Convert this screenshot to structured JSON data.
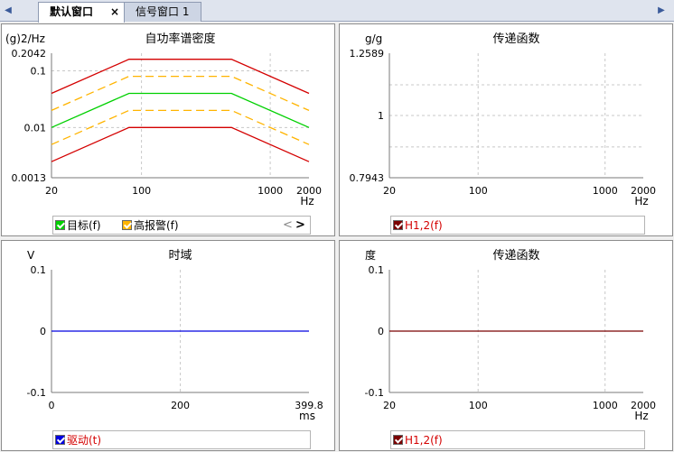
{
  "tabs": [
    {
      "label": "默认窗口",
      "active": true,
      "close": "×"
    },
    {
      "label": "信号窗口 1",
      "active": false
    }
  ],
  "tab_nav": {
    "left": "◀",
    "right": "▶"
  },
  "colors": {
    "abort": "#d40000",
    "alarm": "#ffb400",
    "target": "#00d000",
    "drive": "#0000e0",
    "h12": "#7a0000",
    "grid": "#c8c8c8"
  },
  "panels": {
    "psd": {
      "title": "自功率谱密度",
      "unit": "(g)2/Hz",
      "x_unit": "Hz",
      "legend": [
        {
          "label": "目标(f)",
          "color": "#00d000",
          "checked": true
        },
        {
          "label": "高报警(f)",
          "color": "#ffb400",
          "checked": true
        }
      ],
      "legend_nav": {
        "prev": "<",
        "next": ">"
      }
    },
    "tf_top": {
      "title": "传递函数",
      "unit": "g/g",
      "x_unit": "Hz",
      "legend": [
        {
          "label": "H1,2(f)",
          "color": "#7a0000",
          "checked": true
        }
      ]
    },
    "time": {
      "title": "时域",
      "unit": "V",
      "x_unit": "ms",
      "legend": [
        {
          "label": "驱动(t)",
          "color": "#0000e0",
          "checked": true
        }
      ]
    },
    "tf_bottom": {
      "title": "传递函数",
      "unit": "度",
      "x_unit": "Hz",
      "legend": [
        {
          "label": "H1,2(f)",
          "color": "#7a0000",
          "checked": true
        }
      ]
    }
  },
  "chart_data": [
    {
      "type": "line",
      "title": "自功率谱密度",
      "ylabel": "(g)2/Hz",
      "xlabel": "Hz",
      "xscale": "log",
      "yscale": "log",
      "xlim": [
        20,
        2000
      ],
      "ylim": [
        0.0013,
        0.2042
      ],
      "x_ticks": [
        "20",
        "100",
        "1000",
        "2000"
      ],
      "y_ticks": [
        "0.2042",
        "0.1",
        "0.01",
        "0.0013"
      ],
      "grid": true,
      "series": [
        {
          "name": "",
          "role": "abort-high",
          "style": "solid",
          "color": "#d40000",
          "x": [
            20,
            80,
            500,
            2000
          ],
          "y": [
            0.04,
            0.16,
            0.16,
            0.04
          ]
        },
        {
          "name": "高报警(f)",
          "role": "alarm-high",
          "style": "dashed",
          "color": "#ffb400",
          "x": [
            20,
            80,
            500,
            2000
          ],
          "y": [
            0.02,
            0.08,
            0.08,
            0.02
          ]
        },
        {
          "name": "目标(f)",
          "role": "target",
          "style": "solid",
          "color": "#00d000",
          "x": [
            20,
            80,
            500,
            2000
          ],
          "y": [
            0.01,
            0.04,
            0.04,
            0.01
          ]
        },
        {
          "name": "",
          "role": "alarm-low",
          "style": "dashed",
          "color": "#ffb400",
          "x": [
            20,
            80,
            500,
            2000
          ],
          "y": [
            0.005,
            0.02,
            0.02,
            0.005
          ]
        },
        {
          "name": "",
          "role": "abort-low",
          "style": "solid",
          "color": "#d40000",
          "x": [
            20,
            80,
            500,
            2000
          ],
          "y": [
            0.0025,
            0.01,
            0.01,
            0.0025
          ]
        }
      ]
    },
    {
      "type": "line",
      "title": "传递函数",
      "ylabel": "g/g",
      "xlabel": "Hz",
      "xscale": "log",
      "yscale": "log",
      "xlim": [
        20,
        2000
      ],
      "ylim": [
        0.7943,
        1.2589
      ],
      "x_ticks": [
        "20",
        "100",
        "1000",
        "2000"
      ],
      "y_ticks": [
        "1.2589",
        "1",
        "0.7943"
      ],
      "grid": true,
      "series": []
    },
    {
      "type": "line",
      "title": "时域",
      "ylabel": "V",
      "xlabel": "ms",
      "xscale": "linear",
      "yscale": "linear",
      "xlim": [
        0,
        399.8
      ],
      "ylim": [
        -0.1,
        0.1
      ],
      "x_ticks": [
        "0",
        "200",
        "399.8"
      ],
      "y_ticks": [
        "0.1",
        "0",
        "-0.1"
      ],
      "grid": true,
      "series": [
        {
          "name": "驱动(t)",
          "color": "#0000e0",
          "style": "solid",
          "x": [
            0,
            399.8
          ],
          "y": [
            0,
            0
          ]
        }
      ]
    },
    {
      "type": "line",
      "title": "传递函数",
      "ylabel": "度",
      "xlabel": "Hz",
      "xscale": "log",
      "yscale": "linear",
      "xlim": [
        20,
        2000
      ],
      "ylim": [
        -0.1,
        0.1
      ],
      "x_ticks": [
        "20",
        "100",
        "1000",
        "2000"
      ],
      "y_ticks": [
        "0.1",
        "0",
        "-0.1"
      ],
      "grid": true,
      "series": [
        {
          "name": "H1,2(f)",
          "color": "#7a0000",
          "style": "solid",
          "x": [
            20,
            2000
          ],
          "y": [
            0,
            0
          ]
        }
      ]
    }
  ]
}
